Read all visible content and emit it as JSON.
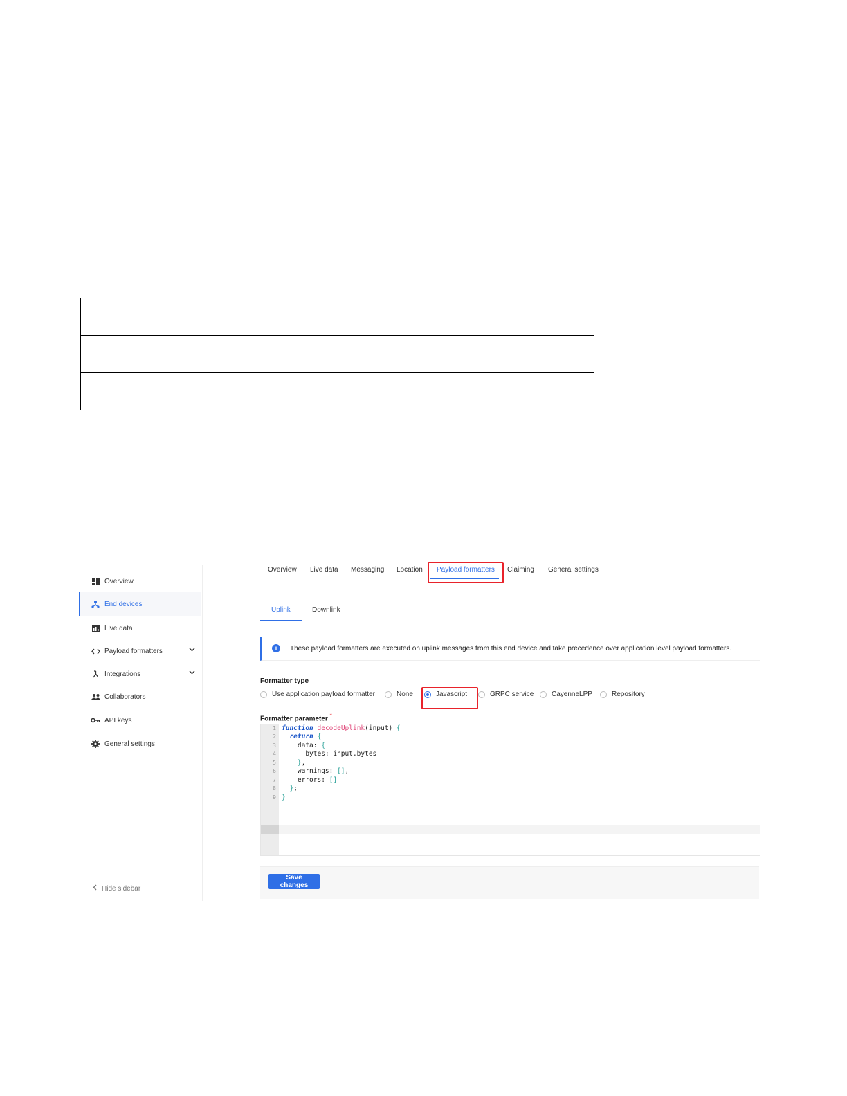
{
  "table": {
    "rows": [
      [
        "",
        "",
        ""
      ],
      [
        "",
        "",
        ""
      ],
      [
        "",
        "",
        ""
      ]
    ]
  },
  "sidebar": {
    "items": [
      {
        "label": "Overview",
        "icon": "dashboard-icon"
      },
      {
        "label": "End devices",
        "icon": "devices-icon"
      },
      {
        "label": "Live data",
        "icon": "chart-icon"
      },
      {
        "label": "Payload formatters",
        "icon": "code-icon"
      },
      {
        "label": "Integrations",
        "icon": "integrations-icon"
      },
      {
        "label": "Collaborators",
        "icon": "people-icon"
      },
      {
        "label": "API keys",
        "icon": "key-icon"
      },
      {
        "label": "General settings",
        "icon": "gear-icon"
      }
    ],
    "hide_label": "Hide sidebar"
  },
  "tabs": [
    "Overview",
    "Live data",
    "Messaging",
    "Location",
    "Payload formatters",
    "Claiming",
    "General settings"
  ],
  "subtabs": [
    "Uplink",
    "Downlink"
  ],
  "info_text": "These payload formatters are executed on uplink messages from this end device and take precedence over application level payload formatters.",
  "formatter_type_label": "Formatter type",
  "formatter_options": [
    "Use application payload formatter",
    "None",
    "Javascript",
    "GRPC service",
    "CayenneLPP",
    "Repository"
  ],
  "selected_option": "Javascript",
  "formatter_parameter_label": "Formatter parameter",
  "required_mark": "*",
  "code_line_numbers": [
    "1",
    "2",
    "3",
    "4",
    "5",
    "6",
    "7",
    "8",
    "9"
  ],
  "save_label": "Save changes",
  "colors": {
    "accent": "#2f6fe6",
    "highlight": "#e8232b"
  }
}
